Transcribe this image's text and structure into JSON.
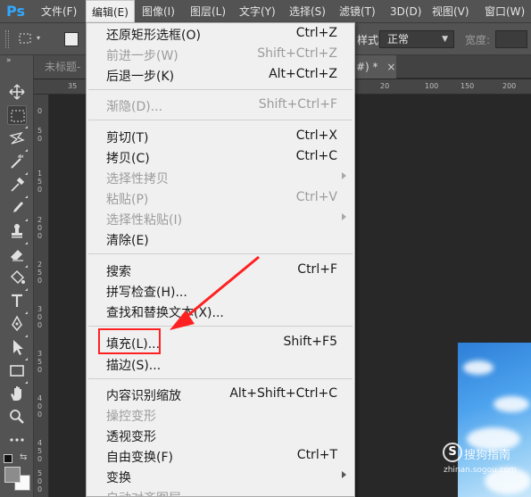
{
  "app_logo": "Ps",
  "menubar": {
    "items": [
      "文件(F)",
      "编辑(E)",
      "图像(I)",
      "图层(L)",
      "文字(Y)",
      "选择(S)",
      "滤镜(T)",
      "3D(D)",
      "视图(V)",
      "窗口(W)"
    ]
  },
  "options": {
    "style_label": "样式:",
    "style_value": "正常",
    "width_label": "宽度:"
  },
  "tabs": {
    "untitled": "未标题-",
    "active_tail": "#) *",
    "close": "×"
  },
  "rulers": {
    "top": [
      "35",
      "20",
      "100",
      "150",
      "200"
    ],
    "left": [
      "0",
      "5",
      "0",
      "1",
      "5",
      "0",
      "2",
      "0",
      "0",
      "2",
      "5",
      "0",
      "3",
      "0",
      "0",
      "3",
      "5",
      "0",
      "4",
      "0",
      "0",
      "4",
      "5",
      "0",
      "5",
      "0",
      "0"
    ]
  },
  "edit_menu": {
    "groups": [
      [
        {
          "label": "还原矩形选框(O)",
          "shortcut": "Ctrl+Z",
          "disabled": false
        },
        {
          "label": "前进一步(W)",
          "shortcut": "Shift+Ctrl+Z",
          "disabled": true
        },
        {
          "label": "后退一步(K)",
          "shortcut": "Alt+Ctrl+Z",
          "disabled": false
        }
      ],
      [
        {
          "label": "渐隐(D)...",
          "shortcut": "Shift+Ctrl+F",
          "disabled": true
        }
      ],
      [
        {
          "label": "剪切(T)",
          "shortcut": "Ctrl+X",
          "disabled": false
        },
        {
          "label": "拷贝(C)",
          "shortcut": "Ctrl+C",
          "disabled": false
        },
        {
          "label": "选择性拷贝",
          "shortcut": "",
          "disabled": true,
          "submenu": true
        },
        {
          "label": "粘贴(P)",
          "shortcut": "Ctrl+V",
          "disabled": true
        },
        {
          "label": "选择性粘贴(I)",
          "shortcut": "",
          "disabled": true,
          "submenu": true
        },
        {
          "label": "清除(E)",
          "shortcut": "",
          "disabled": false
        }
      ],
      [
        {
          "label": "搜索",
          "shortcut": "Ctrl+F",
          "disabled": false
        },
        {
          "label": "拼写检查(H)...",
          "shortcut": "",
          "disabled": false
        },
        {
          "label": "查找和替换文本(X)...",
          "shortcut": "",
          "disabled": false
        }
      ],
      [
        {
          "label": "填充(L)...",
          "shortcut": "Shift+F5",
          "disabled": false
        },
        {
          "label": "描边(S)...",
          "shortcut": "",
          "disabled": false
        }
      ],
      [
        {
          "label": "内容识别缩放",
          "shortcut": "Alt+Shift+Ctrl+C",
          "disabled": false
        },
        {
          "label": "操控变形",
          "shortcut": "",
          "disabled": true
        },
        {
          "label": "透视变形",
          "shortcut": "",
          "disabled": false
        },
        {
          "label": "自由变换(F)",
          "shortcut": "Ctrl+T",
          "disabled": false
        },
        {
          "label": "变换",
          "shortcut": "",
          "disabled": false,
          "submenu": true
        },
        {
          "label": "自动对齐图层...",
          "shortcut": "",
          "disabled": true
        }
      ]
    ]
  },
  "toolbar": {
    "tools": [
      "move-icon",
      "marquee-icon",
      "lasso-icon",
      "magic-wand-icon",
      "eyedropper-icon",
      "brush-icon",
      "stamp-icon",
      "eraser-icon",
      "paint-bucket-icon",
      "text-icon",
      "pen-icon",
      "path-select-icon",
      "rectangle-icon",
      "hand-icon",
      "zoom-icon",
      "more-icon"
    ]
  },
  "watermark": {
    "logo": "S",
    "text": "搜狗指南",
    "url": "zhinan.sogou.com"
  },
  "colors": {
    "highlight": "#ff2121",
    "arrow": "#ff2121",
    "ps_blue": "#31a8ff"
  }
}
